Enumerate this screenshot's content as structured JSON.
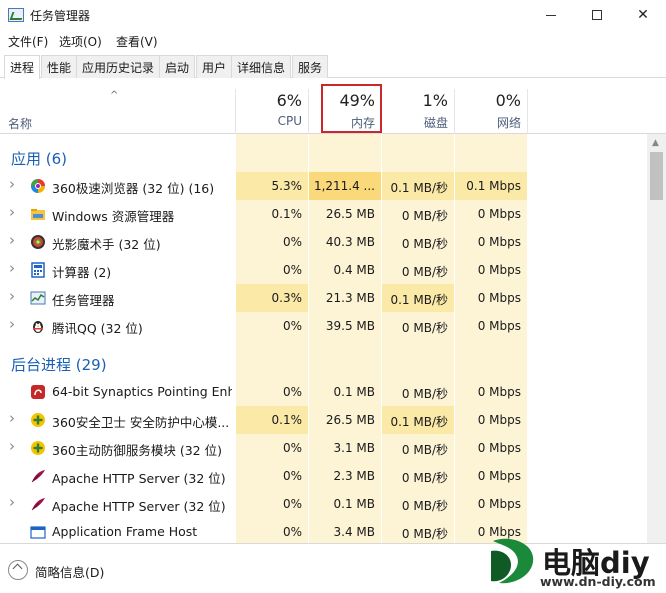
{
  "window": {
    "title": "任务管理器",
    "minimize_glyph": "",
    "maximize_glyph": "",
    "close_glyph": "✕"
  },
  "menu": [
    "文件(F)",
    "选项(O)",
    "查看(V)"
  ],
  "tabs": [
    "进程",
    "性能",
    "应用历史记录",
    "启动",
    "用户",
    "详细信息",
    "服务"
  ],
  "header": {
    "sort_caret": "^",
    "name_label": "名称",
    "columns": [
      {
        "pct": "6%",
        "name": "CPU"
      },
      {
        "pct": "49%",
        "name": "内存"
      },
      {
        "pct": "1%",
        "name": "磁盘"
      },
      {
        "pct": "0%",
        "name": "网络"
      }
    ]
  },
  "groups": {
    "apps": "应用 (6)",
    "background": "后台进程 (29)"
  },
  "apps": [
    {
      "name": "360极速浏览器 (32 位) (16)",
      "cpu": "5.3%",
      "mem": "1,211.4 ...",
      "disk": "0.1 MB/秒",
      "net": "0.1 Mbps",
      "icon": "chrome-icon"
    },
    {
      "name": "Windows 资源管理器",
      "cpu": "0.1%",
      "mem": "26.5 MB",
      "disk": "0 MB/秒",
      "net": "0 Mbps",
      "icon": "folder-icon"
    },
    {
      "name": "光影魔术手 (32 位)",
      "cpu": "0%",
      "mem": "40.3 MB",
      "disk": "0 MB/秒",
      "net": "0 Mbps",
      "icon": "camera-lens-icon"
    },
    {
      "name": "计算器 (2)",
      "cpu": "0%",
      "mem": "0.4 MB",
      "disk": "0 MB/秒",
      "net": "0 Mbps",
      "icon": "calculator-icon"
    },
    {
      "name": "任务管理器",
      "cpu": "0.3%",
      "mem": "21.3 MB",
      "disk": "0.1 MB/秒",
      "net": "0 Mbps",
      "icon": "task-manager-icon"
    },
    {
      "name": "腾讯QQ (32 位)",
      "cpu": "0%",
      "mem": "39.5 MB",
      "disk": "0 MB/秒",
      "net": "0 Mbps",
      "icon": "penguin-icon"
    }
  ],
  "background": [
    {
      "name": "64-bit Synaptics Pointing Enh...",
      "cpu": "0%",
      "mem": "0.1 MB",
      "disk": "0 MB/秒",
      "net": "0 Mbps",
      "icon": "synaptics-icon",
      "chev": false
    },
    {
      "name": "360安全卫士 安全防护中心模...",
      "cpu": "0.1%",
      "mem": "26.5 MB",
      "disk": "0.1 MB/秒",
      "net": "0 Mbps",
      "icon": "shield-plus-icon",
      "chev": true
    },
    {
      "name": "360主动防御服务模块 (32 位)",
      "cpu": "0%",
      "mem": "3.1 MB",
      "disk": "0 MB/秒",
      "net": "0 Mbps",
      "icon": "shield-plus-icon",
      "chev": true
    },
    {
      "name": "Apache HTTP Server (32 位)",
      "cpu": "0%",
      "mem": "2.3 MB",
      "disk": "0 MB/秒",
      "net": "0 Mbps",
      "icon": "feather-icon",
      "chev": false
    },
    {
      "name": "Apache HTTP Server (32 位)",
      "cpu": "0%",
      "mem": "0.1 MB",
      "disk": "0 MB/秒",
      "net": "0 Mbps",
      "icon": "feather-icon",
      "chev": true
    },
    {
      "name": "Application Frame Host",
      "cpu": "0%",
      "mem": "3.4 MB",
      "disk": "0 MB/秒",
      "net": "0 Mbps",
      "icon": "window-frame-icon",
      "chev": false
    }
  ],
  "footer": {
    "label": "简略信息(D)"
  },
  "watermark": {
    "title": "电脑diy",
    "url": "www.dn-diy.com"
  },
  "colors": {
    "accent": "#1a5fb4",
    "highlight_box": "#c8282c",
    "heat_light": "#fdf4d6",
    "heat_mid": "#fbe9a8",
    "heat_strong": "#f9d97a"
  }
}
